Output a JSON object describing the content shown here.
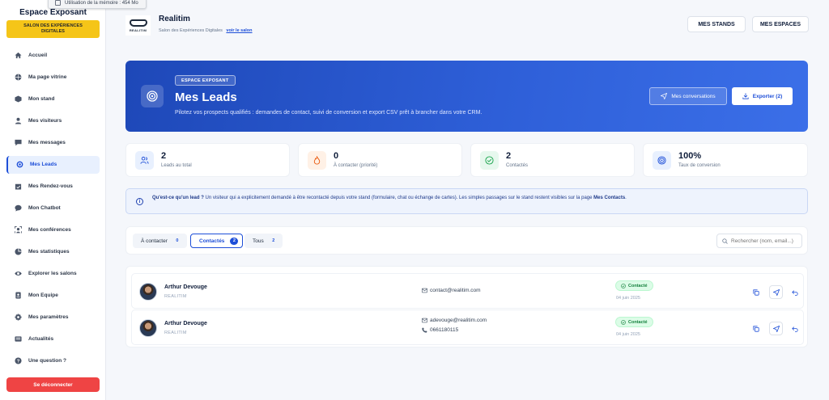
{
  "memory_tooltip": "Utilisation de la mémoire : 454 Mo",
  "sidebar": {
    "title": "Espace Exposant",
    "salon_badge": "SALON DES EXPÉRIENCES DIGITALES",
    "items": [
      {
        "label": "Accueil",
        "icon": "home-icon"
      },
      {
        "label": "Ma page vitrine",
        "icon": "globe-icon"
      },
      {
        "label": "Mon stand",
        "icon": "box-icon"
      },
      {
        "label": "Mes visiteurs",
        "icon": "user-icon"
      },
      {
        "label": "Mes messages",
        "icon": "message-icon"
      },
      {
        "label": "Mes Leads",
        "icon": "target-icon",
        "active": true
      },
      {
        "label": "Mes Rendez-vous",
        "icon": "calendar-icon"
      },
      {
        "label": "Mon Chatbot",
        "icon": "chat-icon"
      },
      {
        "label": "Mes conférences",
        "icon": "conference-icon"
      },
      {
        "label": "Mes statistiques",
        "icon": "pie-chart-icon"
      },
      {
        "label": "Explorer les salons",
        "icon": "eye-icon"
      },
      {
        "label": "Mon Equipe",
        "icon": "badge-icon"
      },
      {
        "label": "Mes paramètres",
        "icon": "gear-icon"
      },
      {
        "label": "Actualités",
        "icon": "news-icon"
      },
      {
        "label": "Une question ?",
        "icon": "help-icon"
      }
    ],
    "logout": "Se déconnecter"
  },
  "header": {
    "logo_text": "REALITIM",
    "brand_name": "Realitim",
    "brand_sub": "Salon des Expériences Digitales",
    "brand_link": "voir le salon",
    "btn_stands": "MES STANDS",
    "btn_espaces": "MES ESPACES"
  },
  "hero": {
    "badge": "ESPACE EXPOSANT",
    "title": "Mes Leads",
    "description": "Pilotez vos prospects qualifiés : demandes de contact, suivi de conversion et export CSV prêt à brancher dans votre CRM.",
    "btn_conversations": "Mes conversations",
    "btn_export": "Exporter (2)"
  },
  "stats": [
    {
      "value": "2",
      "label": "Leads au total",
      "icon": "users-icon"
    },
    {
      "value": "0",
      "label": "À contacter (priorité)",
      "icon": "flame-icon"
    },
    {
      "value": "2",
      "label": "Contactés",
      "icon": "check-circle-icon"
    },
    {
      "value": "100%",
      "label": "Taux de conversion",
      "icon": "target-icon"
    }
  ],
  "info": {
    "question": "Qu'est-ce qu'un lead ?",
    "text": " Un visiteur qui a explicitement demandé à être recontacté depuis votre stand (formulaire, chat ou échange de cartes). Les simples passages sur le stand restent visibles sur la page ",
    "link": "Mes Contacts",
    "end": "."
  },
  "tabs": [
    {
      "label": "À contacter",
      "count": "0"
    },
    {
      "label": "Contactés",
      "count": "2",
      "active": true
    },
    {
      "label": "Tous",
      "count": "2"
    }
  ],
  "search": {
    "placeholder": "Rechercher (nom, email...)"
  },
  "leads": [
    {
      "name": "Arthur Devouge",
      "company": "REALITIM",
      "email": "contact@realitim.com",
      "phone": "",
      "status": "Contacté",
      "date": "04 juin 2025"
    },
    {
      "name": "Arthur Devouge",
      "company": "REALITIM",
      "email": "adevouge@realitim.com",
      "phone": "0661180115",
      "status": "Contacté",
      "date": "04 juin 2025"
    }
  ],
  "colors": {
    "primary": "#1d4ed8",
    "salon_badge": "#f5c518",
    "logout": "#ef4444",
    "status_green": "#15803d"
  }
}
